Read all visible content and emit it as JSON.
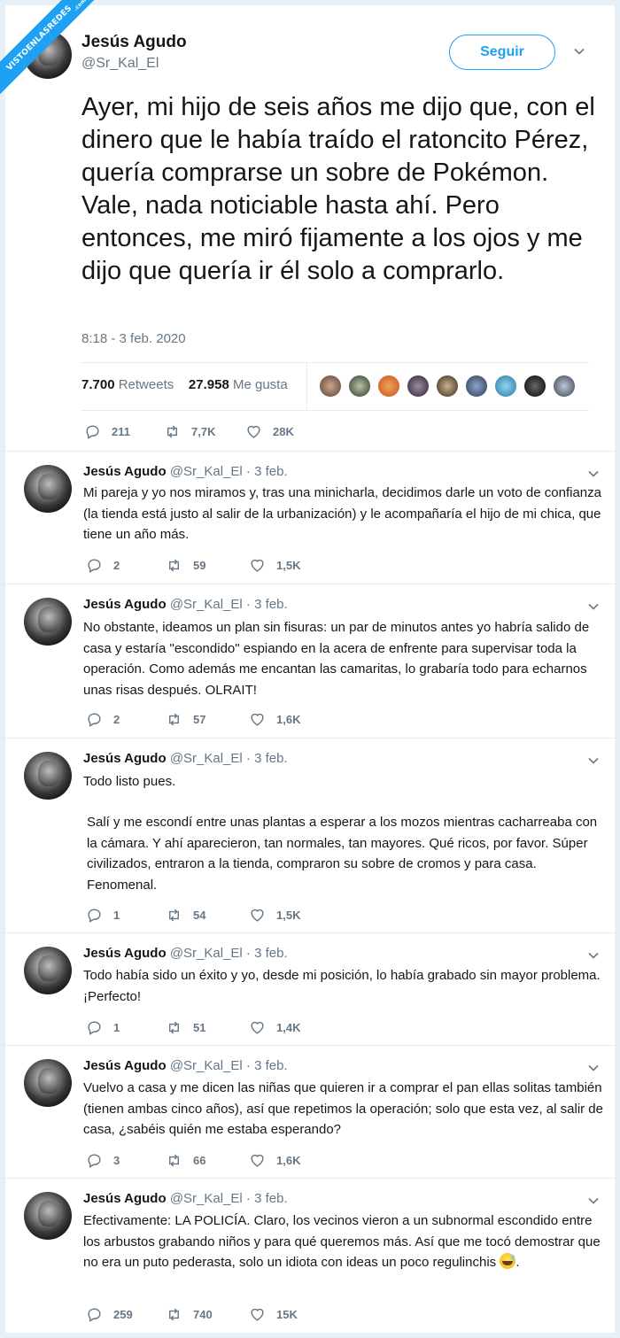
{
  "watermark": {
    "text": "VISTOENLASREDES",
    "suffix": ".com"
  },
  "main": {
    "name": "Jesús Agudo",
    "handle": "@Sr_Kal_El",
    "follow_label": "Seguir",
    "text": "Ayer, mi hijo de seis años me dijo que, con el dinero que le había traído el ratoncito Pérez, quería comprarse un sobre de Pokémon. Vale, nada noticiable hasta ahí. Pero entonces, me miró fijamente a los ojos y me dijo que quería ir él solo a comprarlo.",
    "timestamp": "8:18 - 3 feb. 2020",
    "retweets_count": "7.700",
    "retweets_label": "Retweets",
    "likes_count": "27.958",
    "likes_label": "Me gusta",
    "actions": {
      "replies": "211",
      "retweets": "7,7K",
      "likes": "28K"
    }
  },
  "colors": {
    "accent": "#1da1f2",
    "muted": "#657786",
    "text": "#14171a"
  },
  "replies": [
    {
      "name": "Jesús Agudo",
      "handle": "@Sr_Kal_El",
      "date": "· 3 feb.",
      "text": "Mi pareja y yo nos miramos y, tras una minicharla, decidimos darle un voto de confianza (la tienda está justo al salir de la urbanización) y le acompañaría el hijo de mi chica, que tiene un año más.",
      "replies": "2",
      "retweets": "59",
      "likes": "1,5K"
    },
    {
      "name": "Jesús Agudo",
      "handle": "@Sr_Kal_El",
      "date": "· 3 feb.",
      "text": "No obstante, ideamos un plan sin fisuras: un par de minutos antes yo habría salido de casa y estaría \"escondido\" espiando en la acera de enfrente para supervisar toda la operación. Como además me encantan las camaritas, lo grabaría todo para echarnos unas risas después. OLRAIT!",
      "replies": "2",
      "retweets": "57",
      "likes": "1,6K"
    },
    {
      "name": "Jesús Agudo",
      "handle": "@Sr_Kal_El",
      "date": "· 3 feb.",
      "text": "Todo listo pues.",
      "text2": "Salí y me escondí entre unas plantas a esperar a los mozos mientras cacharreaba con la cámara. Y ahí aparecieron, tan normales, tan mayores. Qué ricos, por favor. Súper civilizados, entraron a la tienda, compraron su sobre de cromos y para casa. Fenomenal.",
      "replies": "1",
      "retweets": "54",
      "likes": "1,5K"
    },
    {
      "name": "Jesús Agudo",
      "handle": "@Sr_Kal_El",
      "date": "· 3 feb.",
      "text": "Todo había sido un éxito y yo, desde mi posición, lo había grabado sin mayor problema. ¡Perfecto!",
      "replies": "1",
      "retweets": "51",
      "likes": "1,4K"
    },
    {
      "name": "Jesús Agudo",
      "handle": "@Sr_Kal_El",
      "date": "· 3 feb.",
      "text": "Vuelvo a casa y me dicen las niñas que quieren ir a comprar el pan ellas solitas también (tienen ambas cinco años), así que repetimos la operación; solo que esta vez, al salir de casa, ¿sabéis quién me estaba esperando?",
      "replies": "3",
      "retweets": "66",
      "likes": "1,6K"
    },
    {
      "name": "Jesús Agudo",
      "handle": "@Sr_Kal_El",
      "date": "· 3 feb.",
      "text": "Efectivamente: LA POLICÍA. Claro, los vecinos vieron a un subnormal escondido entre los arbustos grabando niños y para qué queremos más. Así que me tocó demostrar que no era un puto pederasta, solo un idiota con ideas un poco regulinchis",
      "text_end": ".",
      "emoji": "grinning-sweat-emoji",
      "replies": "259",
      "retweets": "740",
      "likes": "15K"
    }
  ]
}
